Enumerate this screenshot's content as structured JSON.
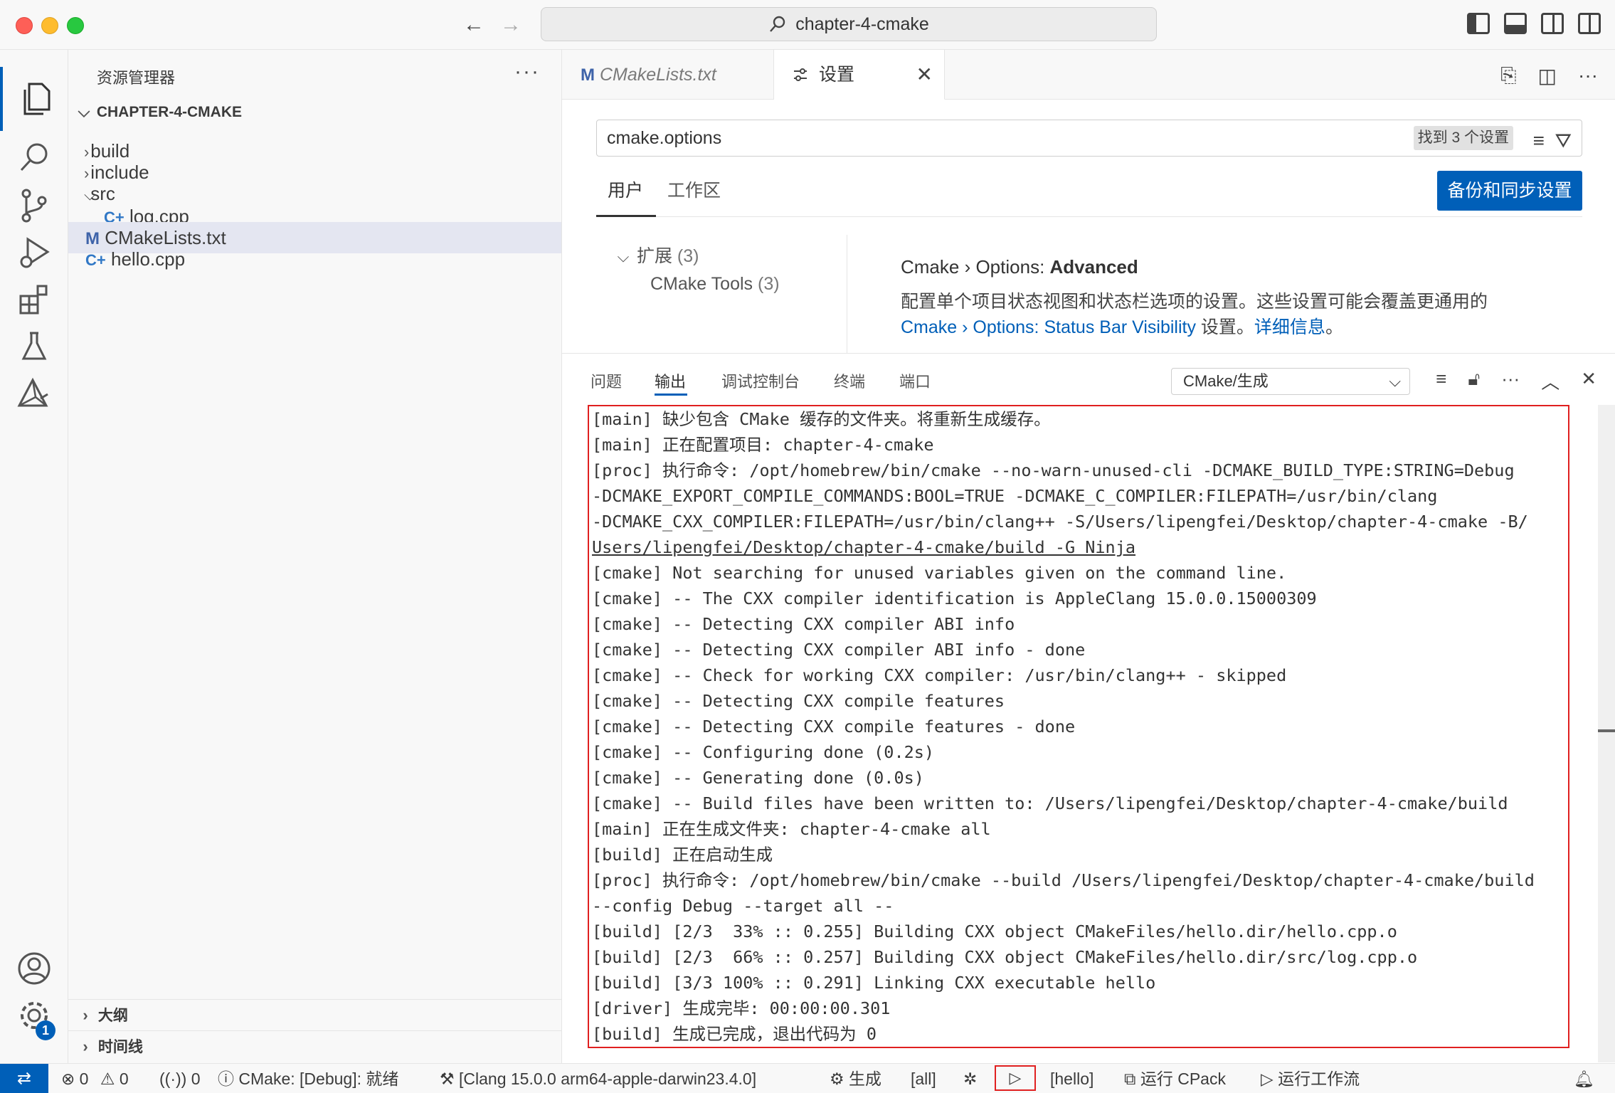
{
  "window": {
    "title": "chapter-4-cmake",
    "back_arrow": "←",
    "forward_arrow": "→"
  },
  "activity_bar": {
    "items": [
      "explorer-icon",
      "search-icon",
      "source-control-icon",
      "run-debug-icon",
      "extensions-icon",
      "testing-icon",
      "cmake-icon"
    ],
    "bottom": [
      "account-icon",
      "manage-gear-icon"
    ],
    "badge": "1"
  },
  "sidebar": {
    "title": "资源管理器",
    "more": "···",
    "root": "CHAPTER-4-CMAKE",
    "tree": [
      {
        "label": "build",
        "type": "folder",
        "expanded": false
      },
      {
        "label": "include",
        "type": "folder",
        "expanded": false
      },
      {
        "label": "src",
        "type": "folder",
        "expanded": true
      },
      {
        "label": "log.cpp",
        "type": "cpp"
      },
      {
        "label": "CMakeLists.txt",
        "type": "cmake",
        "selected": true
      },
      {
        "label": "hello.cpp",
        "type": "cpp"
      }
    ],
    "outline": "大纲",
    "timeline": "时间线"
  },
  "editor": {
    "tabs": [
      {
        "label": "CMakeLists.txt",
        "icon": "M",
        "active": false
      },
      {
        "label": "设置",
        "icon": "settings-icon",
        "active": true
      }
    ],
    "close_glyph": "✕"
  },
  "settings": {
    "search_value": "cmake.options",
    "search_count": "找到 3 个设置",
    "scopes": [
      "用户",
      "工作区"
    ],
    "sync_button": "备份和同步设置",
    "toc": {
      "group": "扩展",
      "group_count": "(3)",
      "child": "CMake Tools",
      "child_count": "(3)"
    },
    "item": {
      "title_prefix": "Cmake › Options: ",
      "title_bold": "Advanced",
      "desc_line1": "配置单个项目状态视图和状态栏选项的设置。这些设置可能会覆盖更通用的",
      "desc_link": "Cmake › Options: Status Bar Visibility",
      "desc_mid": " 设置。",
      "desc_link2": "详细信息",
      "desc_end": "。"
    }
  },
  "panel": {
    "tabs": [
      "问题",
      "输出",
      "调试控制台",
      "终端",
      "端口"
    ],
    "active_tab": "输出",
    "channel": "CMake/生成",
    "output_lines": [
      "[main] 缺少包含 CMake 缓存的文件夹。将重新生成缓存。",
      "[main] 正在配置项目: chapter-4-cmake",
      "[proc] 执行命令: /opt/homebrew/bin/cmake --no-warn-unused-cli -DCMAKE_BUILD_TYPE:STRING=Debug",
      "-DCMAKE_EXPORT_COMPILE_COMMANDS:BOOL=TRUE -DCMAKE_C_COMPILER:FILEPATH=/usr/bin/clang",
      "-DCMAKE_CXX_COMPILER:FILEPATH=/usr/bin/clang++ -S/Users/lipengfei/Desktop/chapter-4-cmake -B/",
      "Users/lipengfei/Desktop/chapter-4-cmake/build -G Ninja",
      "[cmake] Not searching for unused variables given on the command line.",
      "[cmake] -- The CXX compiler identification is AppleClang 15.0.0.15000309",
      "[cmake] -- Detecting CXX compiler ABI info",
      "[cmake] -- Detecting CXX compiler ABI info - done",
      "[cmake] -- Check for working CXX compiler: /usr/bin/clang++ - skipped",
      "[cmake] -- Detecting CXX compile features",
      "[cmake] -- Detecting CXX compile features - done",
      "[cmake] -- Configuring done (0.2s)",
      "[cmake] -- Generating done (0.0s)",
      "[cmake] -- Build files have been written to: /Users/lipengfei/Desktop/chapter-4-cmake/build",
      "[main] 正在生成文件夹: chapter-4-cmake all",
      "[build] 正在启动生成",
      "[proc] 执行命令: /opt/homebrew/bin/cmake --build /Users/lipengfei/Desktop/chapter-4-cmake/build",
      "--config Debug --target all --",
      "[build] [2/3  33% :: 0.255] Building CXX object CMakeFiles/hello.dir/hello.cpp.o",
      "[build] [2/3  66% :: 0.257] Building CXX object CMakeFiles/hello.dir/src/log.cpp.o",
      "[build] [3/3 100% :: 0.291] Linking CXX executable hello",
      "[driver] 生成完毕: 00:00:00.301",
      "[build] 生成已完成，退出代码为 0"
    ]
  },
  "statusbar": {
    "errors": "0",
    "warnings": "0",
    "ports": "0",
    "cmake_status": "CMake: [Debug]: 就绪",
    "kit": "[Clang 15.0.0 arm64-apple-darwin23.4.0]",
    "build": "生成",
    "target": "[all]",
    "launch_target": "[hello]",
    "cpack": "运行 CPack",
    "workflow": "运行工作流"
  },
  "colors": {
    "accent": "#005fb8",
    "highlight_box": "#e02020"
  }
}
